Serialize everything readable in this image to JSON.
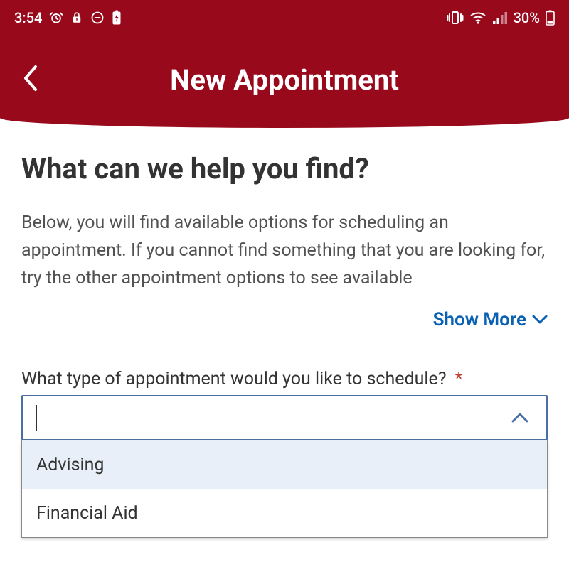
{
  "statusBar": {
    "time": "3:54",
    "batteryPct": "30%",
    "icons": {
      "alarm": "alarm-icon",
      "lock": "lock-icon",
      "dnd": "do-not-disturb-icon",
      "batterySaver": "battery-charging-icon",
      "vibrate": "vibrate-icon",
      "wifi": "wifi-icon",
      "signal": "signal-icon",
      "battery": "battery-icon"
    }
  },
  "header": {
    "title": "New Appointment"
  },
  "page": {
    "title": "What can we help you find?",
    "description": "Below, you will find available options for scheduling an appointment. If you cannot find something that you are looking for, try the other appointment options to see available",
    "showMore": "Show More"
  },
  "form": {
    "typeField": {
      "label": "What type of appointment would you like to schedule?",
      "required": "*",
      "value": "",
      "options": [
        "Advising",
        "Financial Aid"
      ]
    }
  },
  "colors": {
    "brand": "#97091b",
    "link": "#0a61b3",
    "selectBorder": "#4a6fa2",
    "optionHighlight": "#e8eff8"
  }
}
